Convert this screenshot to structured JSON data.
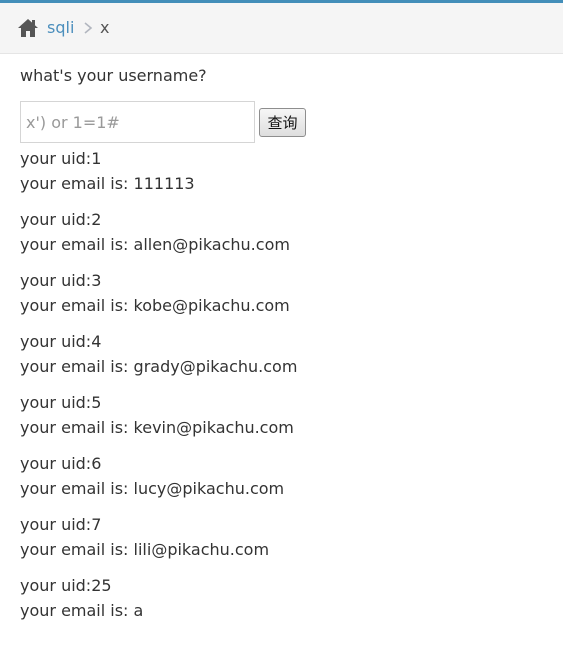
{
  "breadcrumb": {
    "home_icon": "home-icon",
    "link_label": "sqli",
    "separator_icon": "chevron-right-icon",
    "current_label": "x"
  },
  "form": {
    "question": "what's your username?",
    "input_placeholder": "x') or 1=1#",
    "input_value": "",
    "submit_label": "查询"
  },
  "results": [
    {
      "uid": "your uid:1",
      "email": "your email is: 111113"
    },
    {
      "uid": "your uid:2",
      "email": "your email is: allen@pikachu.com"
    },
    {
      "uid": "your uid:3",
      "email": "your email is: kobe@pikachu.com"
    },
    {
      "uid": "your uid:4",
      "email": "your email is: grady@pikachu.com"
    },
    {
      "uid": "your uid:5",
      "email": "your email is: kevin@pikachu.com"
    },
    {
      "uid": "your uid:6",
      "email": "your email is: lucy@pikachu.com"
    },
    {
      "uid": "your uid:7",
      "email": "your email is: lili@pikachu.com"
    },
    {
      "uid": "your uid:25",
      "email": "your email is: a"
    }
  ],
  "colors": {
    "accent_bar": "#438eb9",
    "link": "#4c8fbd",
    "breadcrumb_bg": "#f5f5f5",
    "text": "#333333"
  }
}
